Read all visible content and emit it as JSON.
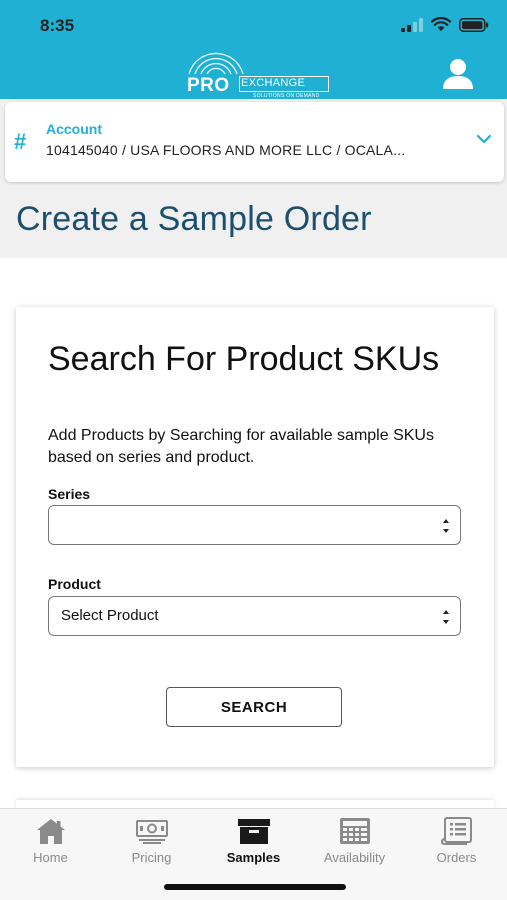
{
  "status_bar": {
    "time": "8:35"
  },
  "header": {
    "logo_pro": "PRO",
    "logo_exchange": "EXCHANGE",
    "logo_tagline": "SOLUTIONS ON DEMAND",
    "accent_color": "#1fb0d3"
  },
  "account": {
    "label": "Account",
    "value": "104145040 / USA FLOORS AND MORE LLC / OCALA..."
  },
  "page": {
    "title": "Create a Sample Order"
  },
  "search_card": {
    "title": "Search For Product SKUs",
    "description": "Add Products by Searching for available sample SKUs based on series and product.",
    "series_label": "Series",
    "series_value": "",
    "product_label": "Product",
    "product_value": "Select Product",
    "search_button": "SEARCH"
  },
  "tabs": [
    {
      "label": "Home",
      "icon": "home-icon",
      "active": false
    },
    {
      "label": "Pricing",
      "icon": "money-icon",
      "active": false
    },
    {
      "label": "Samples",
      "icon": "box-icon",
      "active": true
    },
    {
      "label": "Availability",
      "icon": "calculator-icon",
      "active": false
    },
    {
      "label": "Orders",
      "icon": "document-icon",
      "active": false
    }
  ]
}
